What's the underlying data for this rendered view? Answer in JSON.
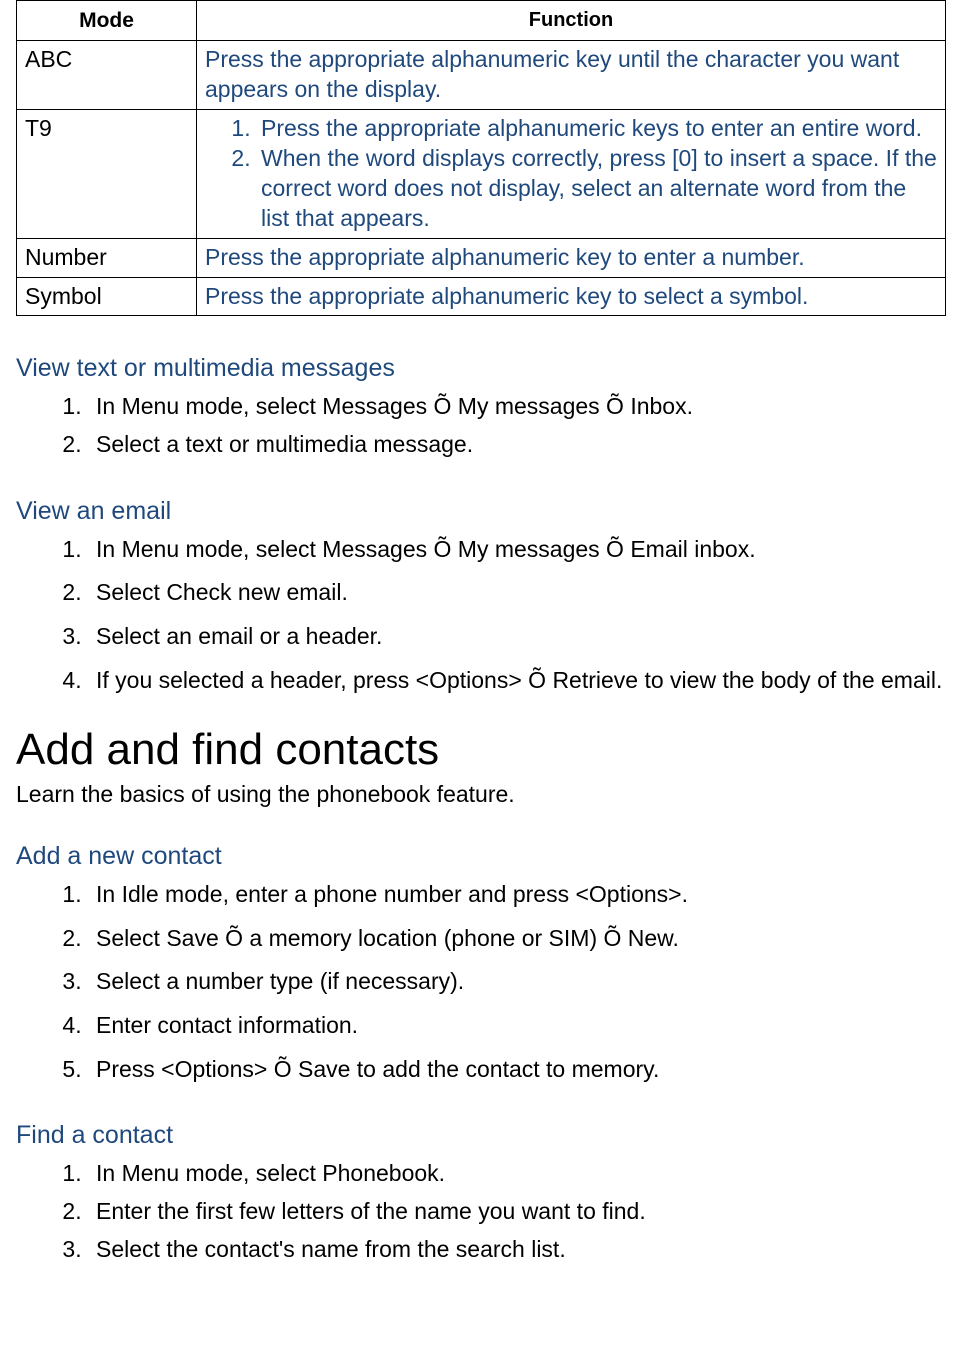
{
  "table": {
    "headers": {
      "mode": "Mode",
      "function": "Function"
    },
    "rows": {
      "abc": {
        "mode": "ABC",
        "function": "Press the appropriate alphanumeric key until the character you want appears on the display."
      },
      "t9": {
        "mode": "T9",
        "steps": [
          "Press the appropriate alphanumeric keys to enter an entire word.",
          "When the word displays correctly, press [0] to insert a space. If the correct word does not display, select an alternate word from the list that appears."
        ]
      },
      "number": {
        "mode": "Number",
        "function": "Press the appropriate alphanumeric key to enter a number."
      },
      "symbol": {
        "mode": "Symbol",
        "function": "Press the appropriate alphanumeric key to select a symbol."
      }
    }
  },
  "sections": {
    "view_messages": {
      "heading": "View text or multimedia messages",
      "steps": [
        "In Menu mode, select Messages Õ My messages Õ Inbox.",
        "Select a text or multimedia message."
      ]
    },
    "view_email": {
      "heading": "View an email",
      "steps": [
        "In Menu mode, select Messages Õ My messages Õ Email inbox.",
        "Select Check new email.",
        "Select an email or a header.",
        "If you selected a header, press <Options> Õ Retrieve to view the body of the email."
      ]
    },
    "contacts": {
      "title": "Add and find contacts",
      "subtitle": "Learn the basics of using the phonebook feature."
    },
    "add_contact": {
      "heading": "Add a new contact",
      "steps": [
        "In Idle mode, enter a phone number and press <Options>.",
        "Select Save Õ a memory location (phone or SIM) Õ New.",
        "Select a number type (if necessary).",
        "Enter contact information.",
        "Press <Options> Õ Save to add the contact to memory."
      ]
    },
    "find_contact": {
      "heading": "Find a contact",
      "steps": [
        "In Menu mode, select Phonebook.",
        "Enter the first few letters of the name you want to find.",
        "Select the contact's name from the search list."
      ]
    }
  }
}
